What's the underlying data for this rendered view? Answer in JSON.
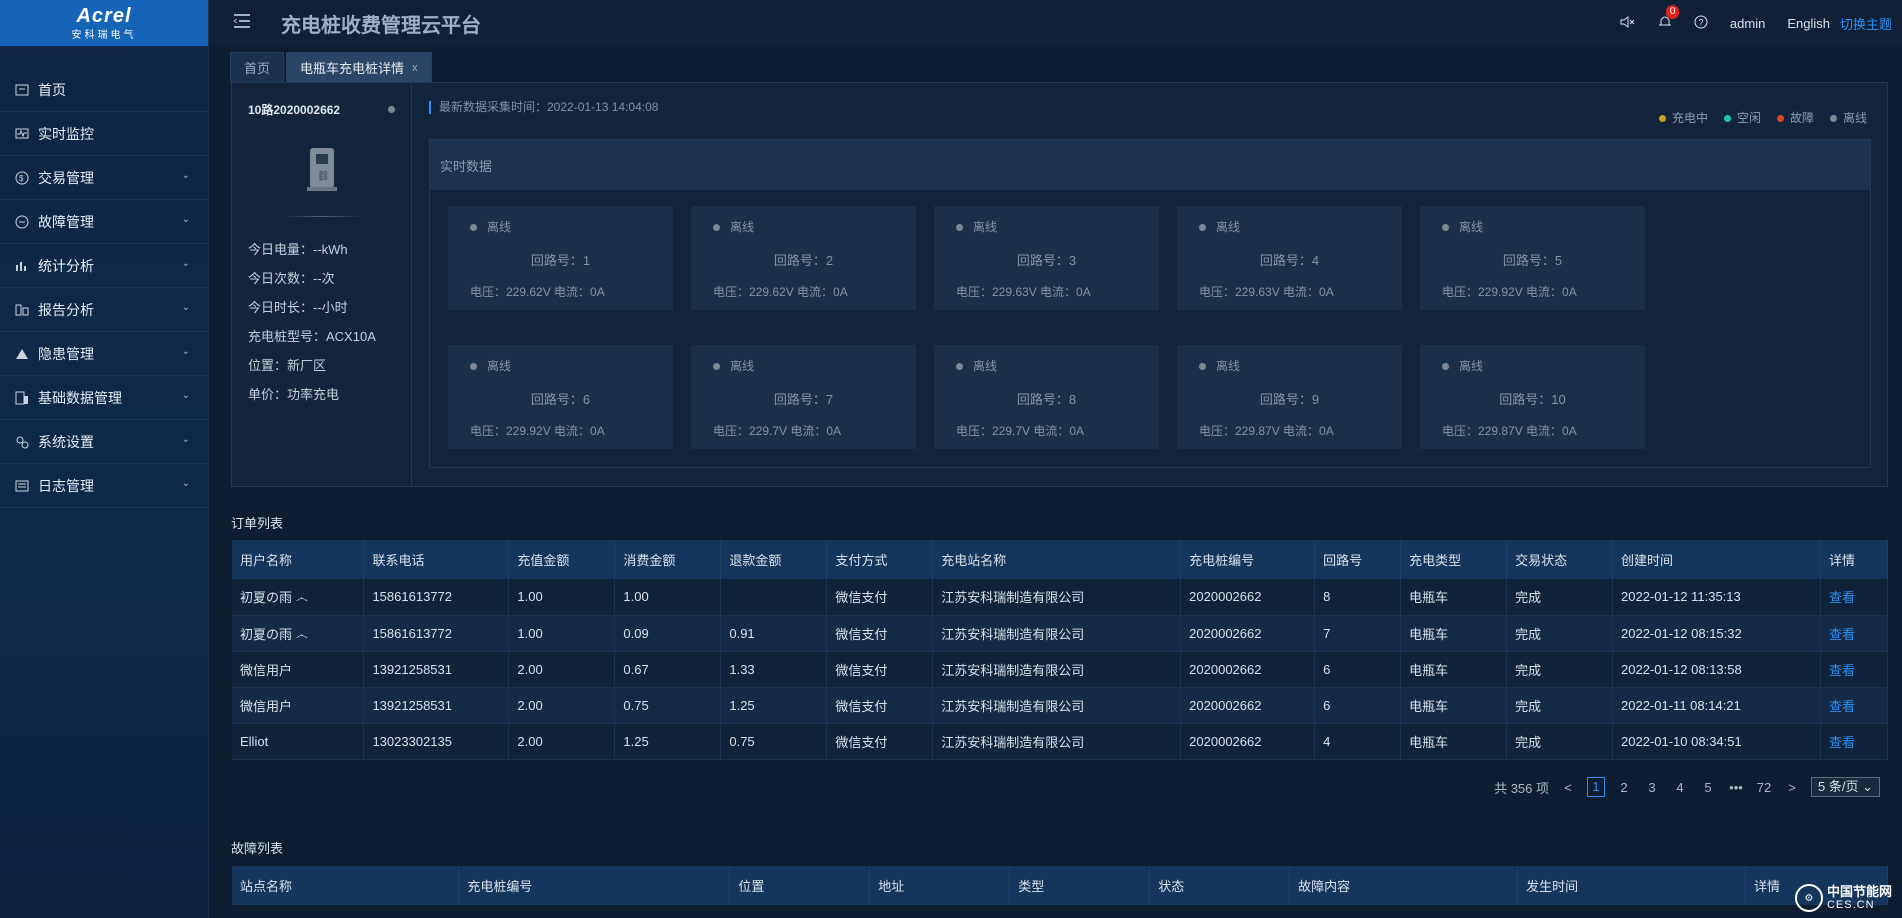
{
  "logo": {
    "brand": "Acrel",
    "sub": "安科瑞电气"
  },
  "app_title": "充电桩收费管理云平台",
  "topbar": {
    "notification_count": "0",
    "user": "admin",
    "language": "English",
    "theme_switch": "切换主题"
  },
  "sidebar": {
    "items": [
      {
        "label": "首页",
        "icon": "home-icon"
      },
      {
        "label": "实时监控",
        "icon": "monitor-icon"
      },
      {
        "label": "交易管理",
        "icon": "transaction-icon"
      },
      {
        "label": "故障管理",
        "icon": "fault-icon"
      },
      {
        "label": "统计分析",
        "icon": "bar-chart-icon"
      },
      {
        "label": "报告分析",
        "icon": "report-icon"
      },
      {
        "label": "隐患管理",
        "icon": "warning-icon"
      },
      {
        "label": "基础数据管理",
        "icon": "database-icon"
      },
      {
        "label": "系统设置",
        "icon": "settings-icon"
      },
      {
        "label": "日志管理",
        "icon": "log-icon"
      }
    ]
  },
  "tabs": [
    {
      "label": "首页"
    },
    {
      "label": "电瓶车充电桩详情",
      "close": "x"
    }
  ],
  "station": {
    "name": "10路2020002662",
    "today_energy": "今日电量：--kWh",
    "today_count": "今日次数：--次",
    "today_duration": "今日时长：--小时",
    "model": "充电桩型号：ACX10A",
    "location": "位置：新厂区",
    "price": "单价：功率充电"
  },
  "timestamp": "最新数据采集时间：2022-01-13 14:04:08",
  "legend": [
    {
      "label": "充电中",
      "color": "#c9a21a"
    },
    {
      "label": "空闲",
      "color": "#1fc8a8"
    },
    {
      "label": "故障",
      "color": "#d9461e"
    },
    {
      "label": "离线",
      "color": "#7d8896"
    }
  ],
  "realtime_title": "实时数据",
  "loops": [
    {
      "status": "离线",
      "loop": "回路号：1",
      "vi": "电压：229.62V    电流：0A"
    },
    {
      "status": "离线",
      "loop": "回路号：2",
      "vi": "电压：229.62V    电流：0A"
    },
    {
      "status": "离线",
      "loop": "回路号：3",
      "vi": "电压：229.63V    电流：0A"
    },
    {
      "status": "离线",
      "loop": "回路号：4",
      "vi": "电压：229.63V    电流：0A"
    },
    {
      "status": "离线",
      "loop": "回路号：5",
      "vi": "电压：229.92V    电流：0A"
    },
    {
      "status": "离线",
      "loop": "回路号：6",
      "vi": "电压：229.92V    电流：0A"
    },
    {
      "status": "离线",
      "loop": "回路号：7",
      "vi": "电压：229.7V    电流：0A"
    },
    {
      "status": "离线",
      "loop": "回路号：8",
      "vi": "电压：229.7V    电流：0A"
    },
    {
      "status": "离线",
      "loop": "回路号：9",
      "vi": "电压：229.87V    电流：0A"
    },
    {
      "status": "离线",
      "loop": "回路号：10",
      "vi": "电压：229.87V    电流：0A"
    }
  ],
  "orders": {
    "title": "订单列表",
    "columns": [
      "用户名称",
      "联系电话",
      "充值金额",
      "消费金额",
      "退款金额",
      "支付方式",
      "充电站名称",
      "充电桩编号",
      "回路号",
      "充电类型",
      "交易状态",
      "创建时间",
      "详情"
    ],
    "rows": [
      [
        "初夏の雨 ෴",
        "15861613772",
        "1.00",
        "1.00",
        "",
        "微信支付",
        "江苏安科瑞制造有限公司",
        "2020002662",
        "8",
        "电瓶车",
        "完成",
        "2022-01-12 11:35:13",
        "查看"
      ],
      [
        "初夏の雨 ෴",
        "15861613772",
        "1.00",
        "0.09",
        "0.91",
        "微信支付",
        "江苏安科瑞制造有限公司",
        "2020002662",
        "7",
        "电瓶车",
        "完成",
        "2022-01-12 08:15:32",
        "查看"
      ],
      [
        "微信用户",
        "13921258531",
        "2.00",
        "0.67",
        "1.33",
        "微信支付",
        "江苏安科瑞制造有限公司",
        "2020002662",
        "6",
        "电瓶车",
        "完成",
        "2022-01-12 08:13:58",
        "查看"
      ],
      [
        "微信用户",
        "13921258531",
        "2.00",
        "0.75",
        "1.25",
        "微信支付",
        "江苏安科瑞制造有限公司",
        "2020002662",
        "6",
        "电瓶车",
        "完成",
        "2022-01-11 08:14:21",
        "查看"
      ],
      [
        "Elliot",
        "13023302135",
        "2.00",
        "1.25",
        "0.75",
        "微信支付",
        "江苏安科瑞制造有限公司",
        "2020002662",
        "4",
        "电瓶车",
        "完成",
        "2022-01-10 08:34:51",
        "查看"
      ]
    ]
  },
  "pager": {
    "total": "共 356 项",
    "prev": "<",
    "pages": [
      "1",
      "2",
      "3",
      "4",
      "5"
    ],
    "ellipsis": "•••",
    "last": "72",
    "next": ">",
    "size": "5 条/页"
  },
  "faults": {
    "title": "故障列表",
    "columns": [
      "站点名称",
      "充电桩编号",
      "位置",
      "地址",
      "类型",
      "状态",
      "故障内容",
      "发生时间",
      "详情"
    ]
  },
  "watermark": {
    "t1": "中国节能网",
    "t2": "CES.CN"
  }
}
